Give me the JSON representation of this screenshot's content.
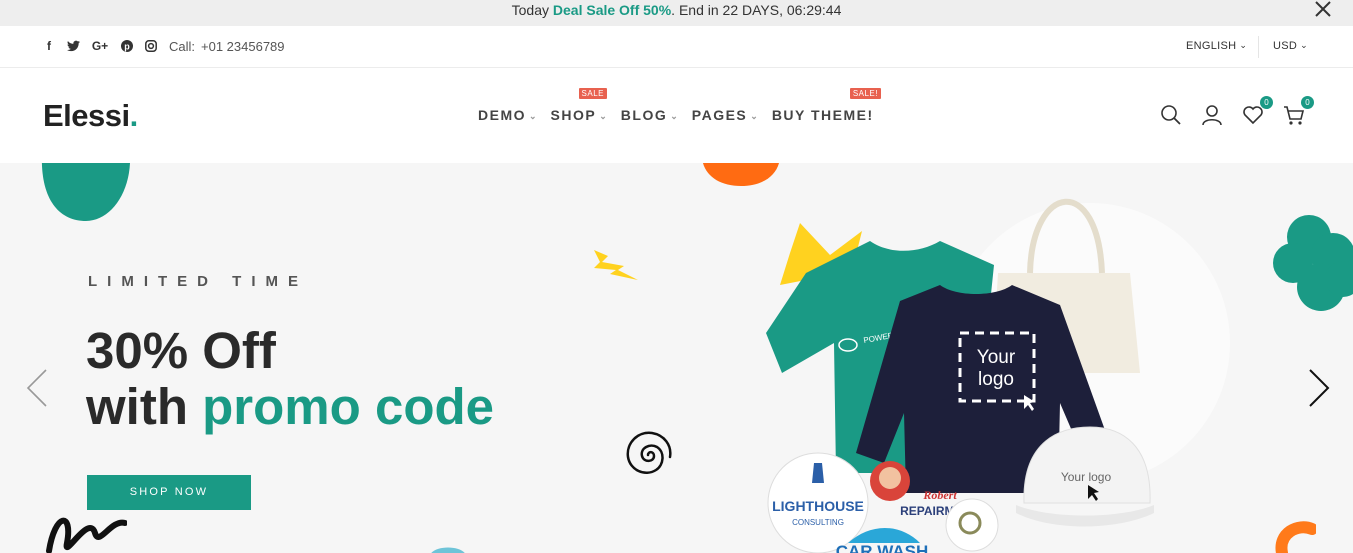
{
  "promo": {
    "prefix": "Today ",
    "highlight": "Deal Sale Off 50%",
    "suffix": ". End in 22 DAYS, 06:29:44"
  },
  "utility": {
    "call_label": "Call:",
    "phone": "+01 23456789",
    "language": "ENGLISH",
    "currency": "USD",
    "social_icons": [
      "facebook-icon",
      "twitter-icon",
      "google-plus-icon",
      "pinterest-icon",
      "instagram-icon"
    ]
  },
  "header": {
    "logo_text": "Elessi",
    "logo_dot": ".",
    "nav": [
      {
        "label": "DEMO",
        "badge": ""
      },
      {
        "label": "SHOP",
        "badge": "SALE"
      },
      {
        "label": "BLOG",
        "badge": ""
      },
      {
        "label": "PAGES",
        "badge": ""
      },
      {
        "label": "BUY THEME!",
        "badge": "SALE!"
      }
    ],
    "wishlist_count": "0",
    "cart_count": "0"
  },
  "hero": {
    "eyebrow": "LIMITED TIME",
    "headline_line1": "30% Off",
    "headline_line2_prefix": "with ",
    "headline_line2_accent": "promo code",
    "cta": "SHOP NOW",
    "product_text_1": "Your",
    "product_text_2": "logo",
    "cap_text": "Your logo",
    "sticker_1": "LIGHTHOUSE",
    "sticker_1_sub": "CONSULTING",
    "sticker_2": "Robert",
    "sticker_2_sub": "REPAIRMAN",
    "sticker_3": "CAR WASH",
    "tshirt_text": "POWER"
  },
  "colors": {
    "accent": "#1a9a85",
    "badge": "#e8614f",
    "orange": "#ff6b12",
    "yellow": "#ffd21f"
  }
}
